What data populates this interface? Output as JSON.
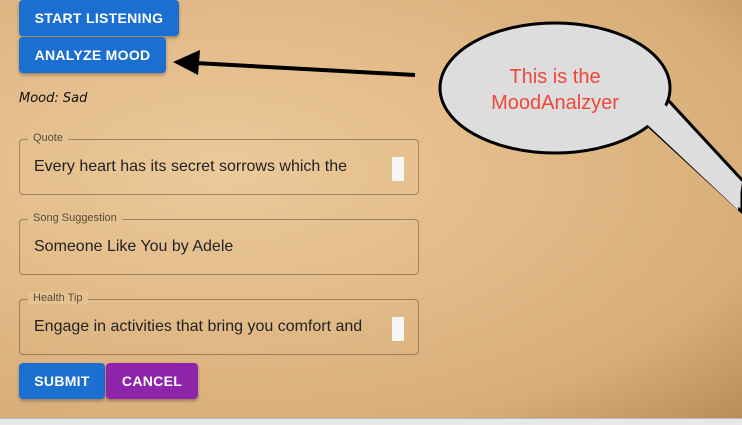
{
  "buttons": {
    "start_listening": "START LISTENING",
    "analyze_mood": "ANALYZE MOOD",
    "submit": "SUBMIT",
    "cancel": "CANCEL"
  },
  "mood": "Mood: Sad",
  "fields": {
    "quote": {
      "label": "Quote",
      "value": "Every heart has its secret sorrows which the"
    },
    "song": {
      "label": "Song Suggestion",
      "value": "Someone Like You by Adele"
    },
    "health": {
      "label": "Health Tip",
      "value": "Engage in activities that bring you comfort and"
    }
  },
  "annotation": {
    "line1": "This is the",
    "line2": "MoodAnalzyer"
  },
  "colors": {
    "primary": "#1b6fd0",
    "secondary": "#8e24aa",
    "annotation_text": "#f0473c"
  }
}
